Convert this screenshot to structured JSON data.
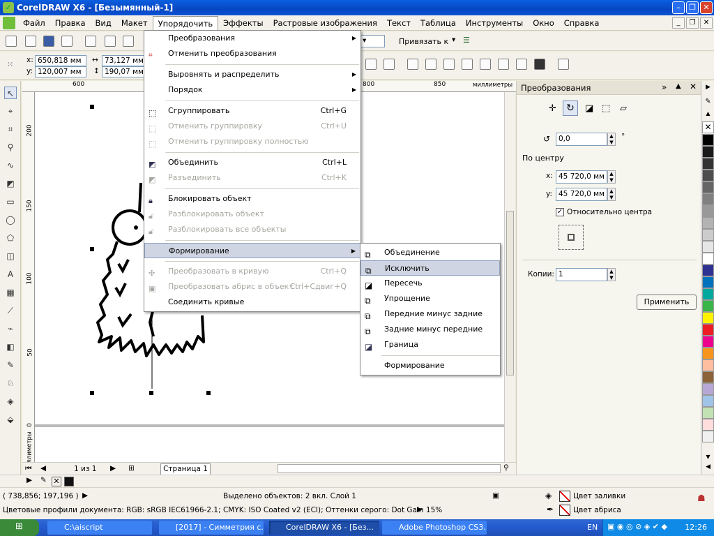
{
  "window": {
    "title": "CorelDRAW X6 - [Безымянный-1]"
  },
  "menubar": {
    "items": [
      "Файл",
      "Правка",
      "Вид",
      "Макет",
      "Упорядочить",
      "Эффекты",
      "Растровые изображения",
      "Текст",
      "Таблица",
      "Инструменты",
      "Окно",
      "Справка"
    ]
  },
  "toolbar": {
    "snap_label": "Привязать к"
  },
  "propbar": {
    "x_label": "x:",
    "x_value": "650,818 мм",
    "y_label": "y:",
    "y_value": "120,007 мм",
    "w_value": "73,127 мм",
    "h_value": "190,07 мм"
  },
  "rulers": {
    "h_ticks": [
      "600",
      "800",
      "850"
    ],
    "h_unit": "миллиметры",
    "v_ticks": [
      "200",
      "150",
      "100",
      "50",
      "0"
    ],
    "v_unit": "миллиметры"
  },
  "arrange_menu": {
    "items": [
      {
        "label": "Преобразования",
        "shortcut": "",
        "submenu": true,
        "disabled": false
      },
      {
        "label": "Отменить преобразования",
        "shortcut": "",
        "submenu": false,
        "disabled": false
      },
      {
        "label": "Выровнять и распределить",
        "shortcut": "",
        "submenu": true,
        "disabled": false
      },
      {
        "label": "Порядок",
        "shortcut": "",
        "submenu": true,
        "disabled": false
      },
      {
        "label": "Сгруппировать",
        "shortcut": "Ctrl+G",
        "submenu": false,
        "disabled": false
      },
      {
        "label": "Отменить группировку",
        "shortcut": "Ctrl+U",
        "submenu": false,
        "disabled": true
      },
      {
        "label": "Отменить группировку полностью",
        "shortcut": "",
        "submenu": false,
        "disabled": true
      },
      {
        "label": "Объединить",
        "shortcut": "Ctrl+L",
        "submenu": false,
        "disabled": false
      },
      {
        "label": "Разъединить",
        "shortcut": "Ctrl+K",
        "submenu": false,
        "disabled": true
      },
      {
        "label": "Блокировать объект",
        "shortcut": "",
        "submenu": false,
        "disabled": false
      },
      {
        "label": "Разблокировать объект",
        "shortcut": "",
        "submenu": false,
        "disabled": true
      },
      {
        "label": "Разблокировать все объекты",
        "shortcut": "",
        "submenu": false,
        "disabled": true
      },
      {
        "label": "Формирование",
        "shortcut": "",
        "submenu": true,
        "disabled": false
      },
      {
        "label": "Преобразовать в кривую",
        "shortcut": "Ctrl+Q",
        "submenu": false,
        "disabled": true
      },
      {
        "label": "Преобразовать абрис в объект",
        "shortcut": "Ctrl+Сдвиг+Q",
        "submenu": false,
        "disabled": true
      },
      {
        "label": "Соединить кривые",
        "shortcut": "",
        "submenu": false,
        "disabled": false
      }
    ]
  },
  "shaping_submenu": {
    "items": [
      "Объединение",
      "Исключить",
      "Пересечь",
      "Упрощение",
      "Передние минус задние",
      "Задние минус передние",
      "Граница",
      "Формирование"
    ]
  },
  "docker": {
    "title": "Преобразования",
    "angle_value": "0,0",
    "degree_sign": "°",
    "center_label": "По центру",
    "x_label": "x:",
    "x_value": "45 720,0 мм",
    "y_label": "y:",
    "y_value": "45 720,0 мм",
    "relative_label": "Относительно центра",
    "copies_label": "Копии:",
    "copies_value": "1",
    "apply_label": "Применить"
  },
  "pages": {
    "counter": "1 из 1",
    "tab": "Страница 1"
  },
  "status": {
    "coords": "( 738,856; 197,196 )",
    "selection": "Выделено объектов: 2 вкл. Слой 1",
    "profiles": "Цветовые профили документа: RGB: sRGB IEC61966-2.1; CMYK: ISO Coated v2 (ECI); Оттенки серого: Dot Gain 15%",
    "fill_label": "Цвет заливки",
    "outline_label": "Цвет абриса"
  },
  "palette_colors": [
    "#ffffff",
    "#000000",
    "#1a1a1a",
    "#333333",
    "#4d4d4d",
    "#666666",
    "#808080",
    "#999999",
    "#b3b3b3",
    "#cccccc",
    "#e6e6e6",
    "#ffffff",
    "#2e3192",
    "#0072bc",
    "#00a99d",
    "#39b54a",
    "#fff200",
    "#ed1c24",
    "#ec008c",
    "#f7941d",
    "#ffbe9f",
    "#8c6239",
    "#b7a7d6",
    "#a0c4e8",
    "#c2e2b4",
    "#fdd",
    "#f0f0f0"
  ],
  "taskbar": {
    "start": "",
    "tasks": [
      "C:\\aiscript",
      "[2017] - Симметрия с...",
      "CorelDRAW X6 - [Без...",
      "Adobe Photoshop CS3..."
    ],
    "lang": "EN",
    "clock": "12:26"
  }
}
